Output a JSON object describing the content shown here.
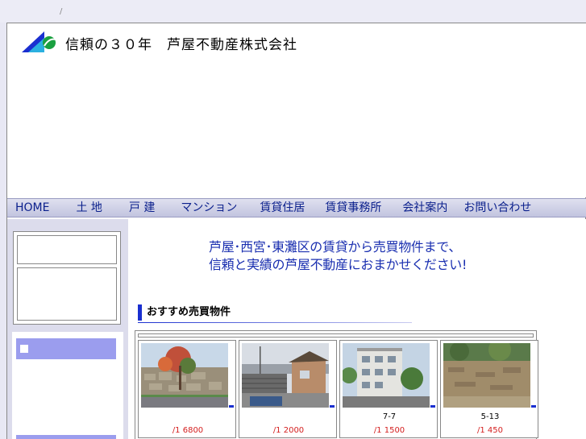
{
  "breadcrumb": "/",
  "site": {
    "title": "信頼の３０年　芦屋不動産株式会社"
  },
  "nav": [
    {
      "label": "HOME"
    },
    {
      "label": "土 地"
    },
    {
      "label": "戸 建"
    },
    {
      "label": "マンション"
    },
    {
      "label": "賃貸住居"
    },
    {
      "label": "賃貸事務所"
    },
    {
      "label": "会社案内"
    },
    {
      "label": "お問い合わせ"
    }
  ],
  "tiny_mark": "!",
  "tagline": [
    "芦屋･西宮･東灘区の賃貸から売買物件まで、",
    "信頼と実績の芦屋不動産におまかせください!"
  ],
  "section": {
    "title": "おすすめ売買物件"
  },
  "listings": [
    {
      "code": "",
      "price": "/1 6800",
      "photo": "stone-wall-tree"
    },
    {
      "code": "",
      "price": "/1 2000",
      "photo": "rooftop-view"
    },
    {
      "code": "7-7",
      "price": "/1 1500",
      "photo": "apartment-building"
    },
    {
      "code": "5-13",
      "price": "/1 450",
      "photo": "empty-lot"
    }
  ],
  "colors": {
    "accent": "#1a2fd0",
    "nav_text": "#0a1f8c",
    "price": "#d42020",
    "sidebar": "#dcdcec"
  }
}
